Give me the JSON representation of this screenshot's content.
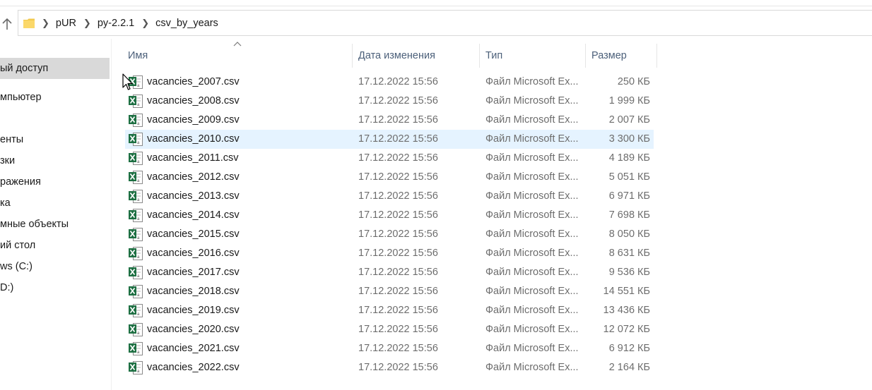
{
  "address": {
    "crumbs": [
      "pUR",
      "py-2.2.1",
      "csv_by_years"
    ]
  },
  "sidebar": {
    "items": [
      {
        "label": "ый доступ",
        "selected": true
      },
      {
        "label": "мпьютер",
        "selected": false
      },
      {
        "label": "енты",
        "selected": false
      },
      {
        "label": "зки",
        "selected": false
      },
      {
        "label": "ражения",
        "selected": false
      },
      {
        "label": "ка",
        "selected": false
      },
      {
        "label": "мные объекты",
        "selected": false
      },
      {
        "label": "ий стол",
        "selected": false
      },
      {
        "label": "ws (C:)",
        "selected": false
      },
      {
        "label": "D:)",
        "selected": false
      }
    ]
  },
  "columns": {
    "name": "Имя",
    "date": "Дата изменения",
    "type": "Тип",
    "size": "Размер"
  },
  "files": [
    {
      "name": "vacancies_2007.csv",
      "date": "17.12.2022 15:56",
      "type": "Файл Microsoft Ex...",
      "size": "250 КБ"
    },
    {
      "name": "vacancies_2008.csv",
      "date": "17.12.2022 15:56",
      "type": "Файл Microsoft Ex...",
      "size": "1 999 КБ"
    },
    {
      "name": "vacancies_2009.csv",
      "date": "17.12.2022 15:56",
      "type": "Файл Microsoft Ex...",
      "size": "2 007 КБ"
    },
    {
      "name": "vacancies_2010.csv",
      "date": "17.12.2022 15:56",
      "type": "Файл Microsoft Ex...",
      "size": "3 300 КБ",
      "hover": true
    },
    {
      "name": "vacancies_2011.csv",
      "date": "17.12.2022 15:56",
      "type": "Файл Microsoft Ex...",
      "size": "4 189 КБ"
    },
    {
      "name": "vacancies_2012.csv",
      "date": "17.12.2022 15:56",
      "type": "Файл Microsoft Ex...",
      "size": "5 051 КБ"
    },
    {
      "name": "vacancies_2013.csv",
      "date": "17.12.2022 15:56",
      "type": "Файл Microsoft Ex...",
      "size": "6 971 КБ"
    },
    {
      "name": "vacancies_2014.csv",
      "date": "17.12.2022 15:56",
      "type": "Файл Microsoft Ex...",
      "size": "7 698 КБ"
    },
    {
      "name": "vacancies_2015.csv",
      "date": "17.12.2022 15:56",
      "type": "Файл Microsoft Ex...",
      "size": "8 050 КБ"
    },
    {
      "name": "vacancies_2016.csv",
      "date": "17.12.2022 15:56",
      "type": "Файл Microsoft Ex...",
      "size": "8 631 КБ"
    },
    {
      "name": "vacancies_2017.csv",
      "date": "17.12.2022 15:56",
      "type": "Файл Microsoft Ex...",
      "size": "9 536 КБ"
    },
    {
      "name": "vacancies_2018.csv",
      "date": "17.12.2022 15:56",
      "type": "Файл Microsoft Ex...",
      "size": "14 551 КБ"
    },
    {
      "name": "vacancies_2019.csv",
      "date": "17.12.2022 15:56",
      "type": "Файл Microsoft Ex...",
      "size": "13 436 КБ"
    },
    {
      "name": "vacancies_2020.csv",
      "date": "17.12.2022 15:56",
      "type": "Файл Microsoft Ex...",
      "size": "12 072 КБ"
    },
    {
      "name": "vacancies_2021.csv",
      "date": "17.12.2022 15:56",
      "type": "Файл Microsoft Ex...",
      "size": "6 912 КБ"
    },
    {
      "name": "vacancies_2022.csv",
      "date": "17.12.2022 15:56",
      "type": "Файл Microsoft Ex...",
      "size": "2 164 КБ"
    }
  ],
  "colors": {
    "selected_sidebar": "#d9d9d9",
    "hover_row": "#e5f3ff",
    "excel_green": "#1d6f42",
    "header_text": "#4c607a"
  },
  "icons": {
    "up": "arrow-up-icon",
    "folder": "folder-icon",
    "file": "excel-csv-icon",
    "sort": "sort-ascending-icon"
  }
}
